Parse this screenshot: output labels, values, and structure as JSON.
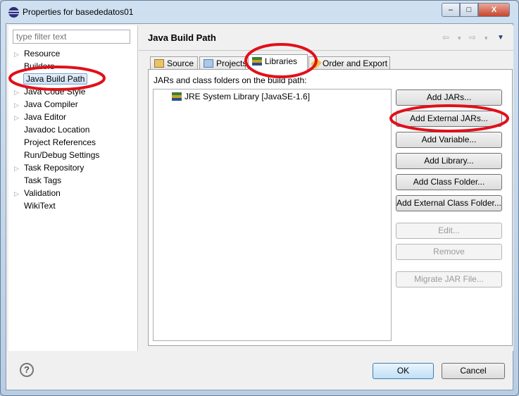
{
  "window": {
    "title": "Properties for basededatos01",
    "minimize": "–",
    "maximize": "□",
    "close": "X"
  },
  "filter": {
    "placeholder": "type filter text"
  },
  "tree": [
    {
      "label": "Resource",
      "expandable": true
    },
    {
      "label": "Builders",
      "expandable": false
    },
    {
      "label": "Java Build Path",
      "expandable": false,
      "selected": true
    },
    {
      "label": "Java Code Style",
      "expandable": true
    },
    {
      "label": "Java Compiler",
      "expandable": true
    },
    {
      "label": "Java Editor",
      "expandable": true
    },
    {
      "label": "Javadoc Location",
      "expandable": false
    },
    {
      "label": "Project References",
      "expandable": false
    },
    {
      "label": "Run/Debug Settings",
      "expandable": false
    },
    {
      "label": "Task Repository",
      "expandable": true
    },
    {
      "label": "Task Tags",
      "expandable": false
    },
    {
      "label": "Validation",
      "expandable": true
    },
    {
      "label": "WikiText",
      "expandable": false
    }
  ],
  "page": {
    "title": "Java Build Path",
    "nav": {
      "back": "⇦",
      "fwd": "⇨",
      "menu": "▼",
      "drop": "▾"
    }
  },
  "tabs": [
    {
      "label": "Source"
    },
    {
      "label": "Projects"
    },
    {
      "label": "Libraries",
      "active": true
    },
    {
      "label": "Order and Export"
    }
  ],
  "libraries": {
    "label": "JARs and class folders on the build path:",
    "items": [
      "JRE System Library [JavaSE-1.6]"
    ]
  },
  "buttons": [
    {
      "label": "Add JARs...",
      "enabled": true
    },
    {
      "label": "Add External JARs...",
      "enabled": true
    },
    {
      "label": "Add Variable...",
      "enabled": true
    },
    {
      "label": "Add Library...",
      "enabled": true
    },
    {
      "label": "Add Class Folder...",
      "enabled": true
    },
    {
      "label": "Add External Class Folder...",
      "enabled": true
    },
    {
      "label": "Edit...",
      "enabled": false
    },
    {
      "label": "Remove",
      "enabled": false
    },
    {
      "label": "Migrate JAR File...",
      "enabled": false
    }
  ],
  "footer": {
    "help": "?",
    "ok": "OK",
    "cancel": "Cancel"
  },
  "colors": {
    "annotation": "#e0101a",
    "selection": "#cde0f5"
  }
}
